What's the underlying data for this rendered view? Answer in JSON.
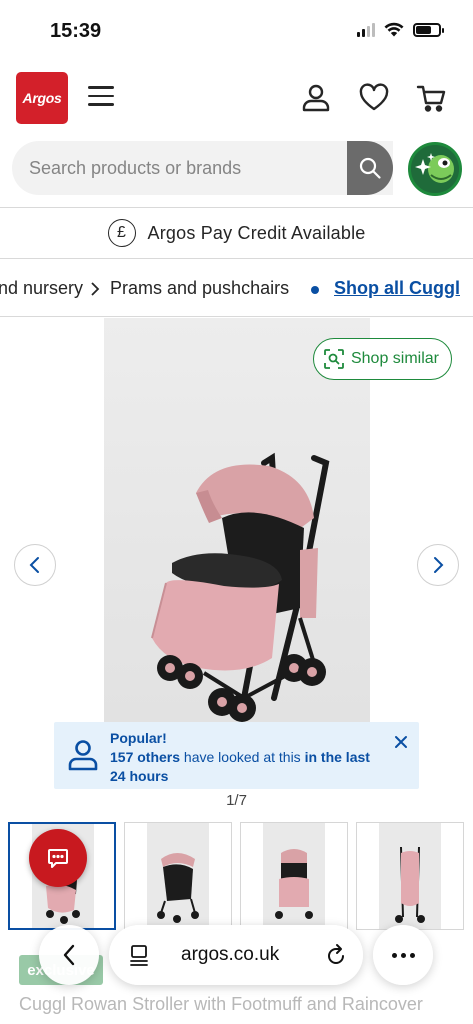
{
  "status_bar": {
    "time": "15:39"
  },
  "header": {
    "logo_text": "Argos"
  },
  "search": {
    "placeholder": "Search products or brands"
  },
  "credit_banner": {
    "icon_glyph": "£",
    "text": "Argos Pay Credit Available"
  },
  "breadcrumb": {
    "items": [
      "nd nursery",
      "Prams and pushchairs"
    ],
    "separator": "›",
    "link": "Shop all Cuggl"
  },
  "gallery": {
    "shop_similar_label": "Shop similar",
    "counter": "1/7"
  },
  "popular_banner": {
    "title": "Popular!",
    "count_text": "157 others",
    "middle_text": " have looked at this ",
    "time_text": "in the last 24 hours"
  },
  "product": {
    "badge": "exclusive",
    "title": "Cuggl Rowan Stroller with Footmuff and Raincover"
  },
  "browser": {
    "url": "argos.co.uk"
  },
  "colors": {
    "brand_red": "#d3202a",
    "link_blue": "#0a4fa3",
    "accent_green": "#1e8a3c",
    "popular_bg": "#e5f1fb"
  },
  "icons": [
    "menu-icon",
    "account-icon",
    "heart-icon",
    "cart-icon",
    "search-icon",
    "assistant-icon",
    "pound-icon",
    "chevron-right-icon",
    "visual-search-icon",
    "chevron-left-icon",
    "person-icon",
    "close-icon",
    "chat-icon",
    "reader-icon",
    "reload-icon",
    "more-icon"
  ]
}
